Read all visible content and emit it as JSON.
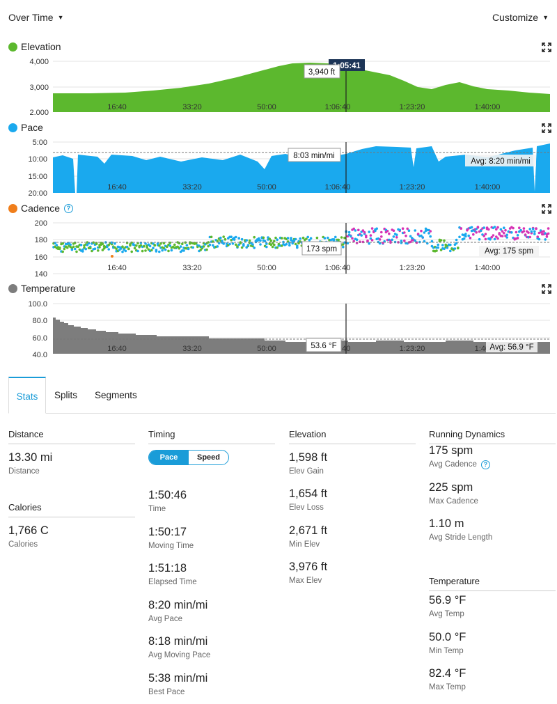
{
  "header": {
    "over_time": "Over Time",
    "customize": "Customize"
  },
  "colors": {
    "elevation": "#5cb82e",
    "pace": "#1aa9ee",
    "cadence": "#f07e1b",
    "cadence_pink": "#d633b5",
    "temperature": "#7d7d7d",
    "accent": "#1a9cd8"
  },
  "charts": [
    {
      "title": "Elevation",
      "icon": "expand-icon",
      "y_ticks": [
        "4,000",
        "3,000",
        "2,000"
      ],
      "x_ticks": [
        "16:40",
        "33:20",
        "50:00",
        "1:06:40",
        "1:23:20",
        "1:40:00"
      ],
      "tooltip": "3,940 ft",
      "cursor_time": "1:05:41"
    },
    {
      "title": "Pace",
      "icon": "expand-icon",
      "y_ticks": [
        "5:00",
        "10:00",
        "15:00",
        "20:00"
      ],
      "x_ticks": [
        "16:40",
        "33:20",
        "50:00",
        "1:06:40",
        "1:23:20",
        "1:40:00"
      ],
      "tooltip": "8:03 min/mi",
      "avg": "Avg: 8:20 min/mi"
    },
    {
      "title": "Cadence",
      "icon": "help-icon",
      "y_ticks": [
        "200",
        "180",
        "160",
        "140"
      ],
      "x_ticks": [
        "16:40",
        "33:20",
        "50:00",
        "1:06:40",
        "1:23:20",
        "1:40:00"
      ],
      "tooltip": "173 spm",
      "avg": "Avg: 175 spm"
    },
    {
      "title": "Temperature",
      "icon": "expand-icon",
      "y_ticks": [
        "100.0",
        "80.0",
        "60.0",
        "40.0"
      ],
      "x_ticks": [
        "16:40",
        "33:20",
        "50:00",
        "1:06:40",
        "1:23:20",
        "1:40:00"
      ],
      "tooltip": "53.6 °F",
      "avg": "Avg: 56.9 °F"
    }
  ],
  "tabs": [
    "Stats",
    "Splits",
    "Segments"
  ],
  "stats": {
    "distance": {
      "head": "Distance",
      "value": "13.30 mi",
      "label": "Distance"
    },
    "calories": {
      "head": "Calories",
      "value": "1,766 C",
      "label": "Calories"
    },
    "timing": {
      "head": "Timing",
      "toggle": [
        "Pace",
        "Speed"
      ],
      "items": [
        {
          "value": "1:50:46",
          "label": "Time"
        },
        {
          "value": "1:50:17",
          "label": "Moving Time"
        },
        {
          "value": "1:51:18",
          "label": "Elapsed Time"
        },
        {
          "value": "8:20 min/mi",
          "label": "Avg Pace"
        },
        {
          "value": "8:18 min/mi",
          "label": "Avg Moving Pace"
        },
        {
          "value": "5:38 min/mi",
          "label": "Best Pace"
        }
      ]
    },
    "elevation": {
      "head": "Elevation",
      "items": [
        {
          "value": "1,598 ft",
          "label": "Elev Gain"
        },
        {
          "value": "1,654 ft",
          "label": "Elev Loss"
        },
        {
          "value": "2,671 ft",
          "label": "Min Elev"
        },
        {
          "value": "3,976 ft",
          "label": "Max Elev"
        }
      ]
    },
    "dynamics": {
      "head": "Running Dynamics",
      "items": [
        {
          "value": "175 spm",
          "label": "Avg Cadence"
        },
        {
          "value": "225 spm",
          "label": "Max Cadence"
        },
        {
          "value": "1.10 m",
          "label": "Avg Stride Length"
        }
      ]
    },
    "temperature": {
      "head": "Temperature",
      "items": [
        {
          "value": "56.9 °F",
          "label": "Avg Temp"
        },
        {
          "value": "50.0 °F",
          "label": "Min Temp"
        },
        {
          "value": "82.4 °F",
          "label": "Max Temp"
        }
      ]
    }
  }
}
